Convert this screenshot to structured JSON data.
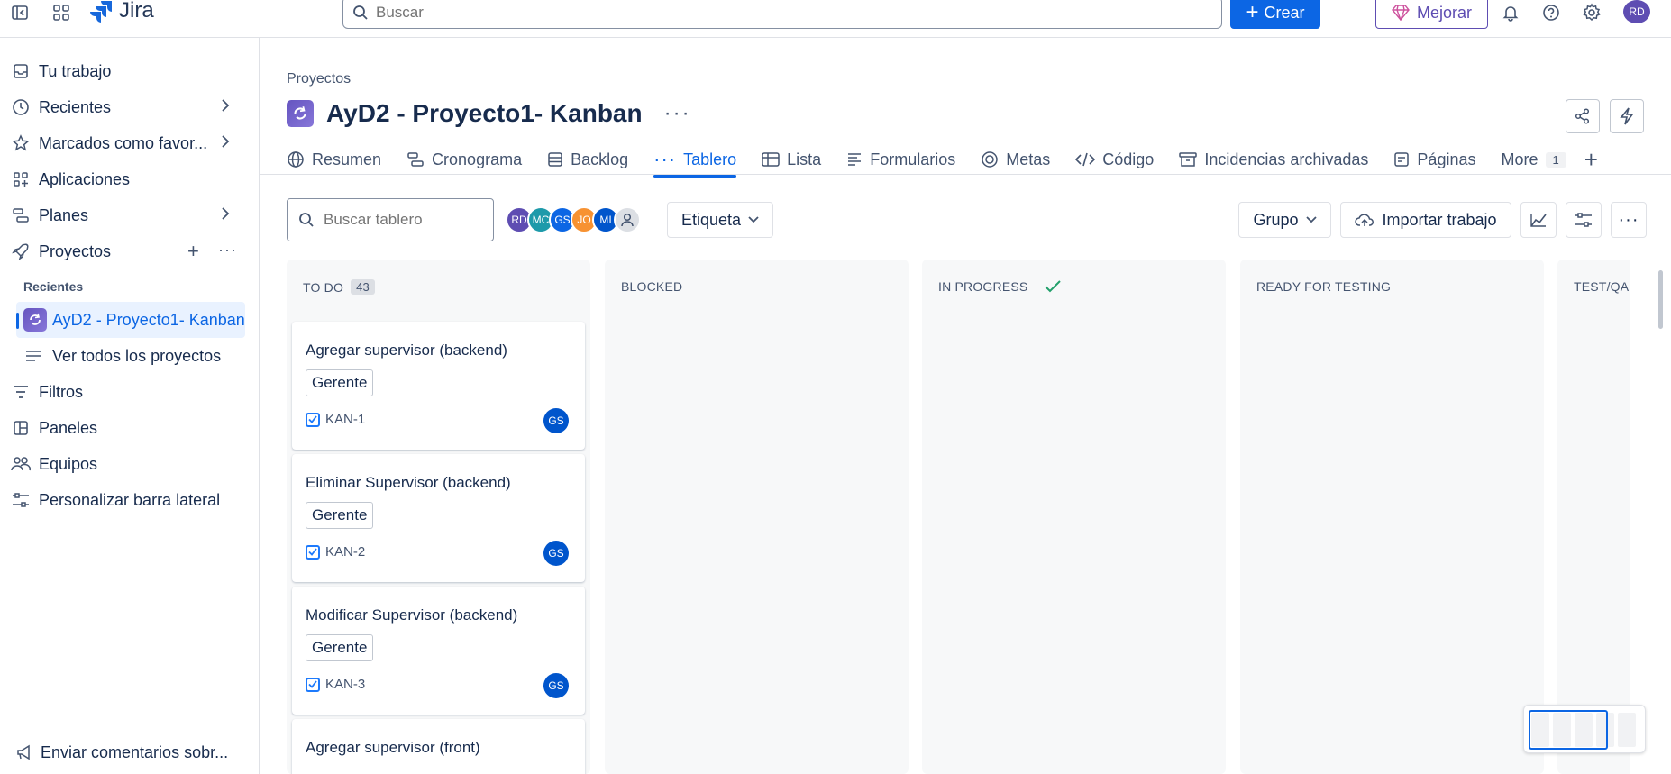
{
  "topbar": {
    "app_name": "Jira",
    "search_placeholder": "Buscar",
    "create_label": "Crear",
    "upgrade_label": "Mejorar",
    "user_initials": "RD"
  },
  "sidebar": {
    "items": [
      {
        "label": "Tu trabajo",
        "icon": "inbox-icon"
      },
      {
        "label": "Recientes",
        "icon": "clock-icon"
      },
      {
        "label": "Marcados como favor...",
        "icon": "star-icon"
      },
      {
        "label": "Aplicaciones",
        "icon": "apps-icon"
      },
      {
        "label": "Planes",
        "icon": "plans-icon"
      },
      {
        "label": "Proyectos",
        "icon": "rocket-icon"
      }
    ],
    "recent_section": "Recientes",
    "recent_project": "AyD2 - Proyecto1- Kanban",
    "view_all_projects": "Ver todos los proyectos",
    "lower_items": [
      {
        "label": "Filtros",
        "icon": "filter-icon"
      },
      {
        "label": "Paneles",
        "icon": "dashboard-icon"
      },
      {
        "label": "Equipos",
        "icon": "teams-icon"
      },
      {
        "label": "Personalizar barra lateral",
        "icon": "customize-icon"
      }
    ],
    "feedback": "Enviar comentarios sobr..."
  },
  "main": {
    "breadcrumb": "Proyectos",
    "title": "AyD2 - Proyecto1- Kanban",
    "tabs": [
      {
        "label": "Resumen",
        "icon": "globe-icon"
      },
      {
        "label": "Cronograma",
        "icon": "timeline-icon"
      },
      {
        "label": "Backlog",
        "icon": "backlog-icon"
      },
      {
        "label": "Tablero",
        "icon": "board-icon",
        "active": true
      },
      {
        "label": "Lista",
        "icon": "list-icon"
      },
      {
        "label": "Formularios",
        "icon": "forms-icon"
      },
      {
        "label": "Metas",
        "icon": "goals-icon"
      },
      {
        "label": "Código",
        "icon": "code-icon"
      },
      {
        "label": "Incidencias archivadas",
        "icon": "archive-icon"
      },
      {
        "label": "Páginas",
        "icon": "pages-icon"
      }
    ],
    "more_label": "More",
    "more_count": "1",
    "board_search_placeholder": "Buscar tablero",
    "avatars": [
      {
        "initials": "RD",
        "color": "#5e4db2"
      },
      {
        "initials": "MC",
        "color": "#1d9aaa"
      },
      {
        "initials": "GS",
        "color": "#0c66e4"
      },
      {
        "initials": "JO",
        "color": "#f79232"
      },
      {
        "initials": "MI",
        "color": "#0055cc"
      }
    ],
    "label_filter": "Etiqueta",
    "group_label": "Grupo",
    "import_label": "Importar trabajo"
  },
  "board": {
    "columns": [
      {
        "name": "TO DO",
        "count": "43"
      },
      {
        "name": "BLOCKED"
      },
      {
        "name": "IN PROGRESS",
        "done": true
      },
      {
        "name": "READY FOR TESTING"
      },
      {
        "name": "TEST/QA"
      }
    ],
    "cards": [
      {
        "title": "Agregar supervisor (backend)",
        "label": "Gerente",
        "key": "KAN-1",
        "assignee": "GS"
      },
      {
        "title": "Eliminar Supervisor (backend)",
        "label": "Gerente",
        "key": "KAN-2",
        "assignee": "GS"
      },
      {
        "title": "Modificar Supervisor (backend)",
        "label": "Gerente",
        "key": "KAN-3",
        "assignee": "GS"
      },
      {
        "title": "Agregar supervisor (front)"
      }
    ]
  }
}
